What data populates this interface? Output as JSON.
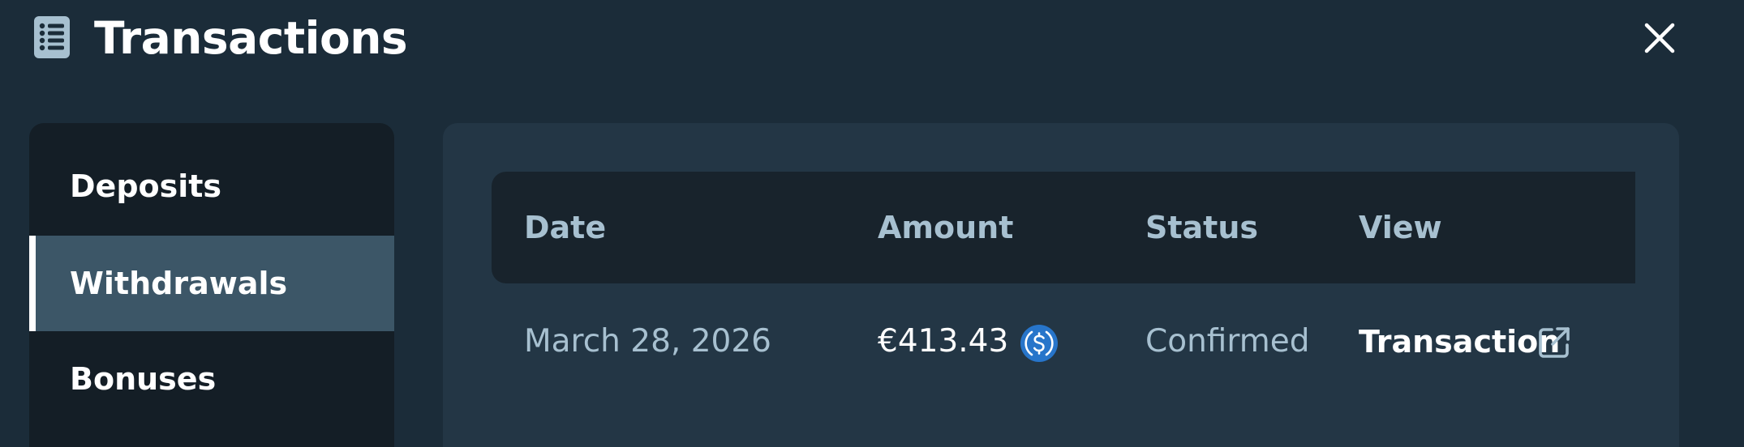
{
  "header": {
    "title": "Transactions",
    "title_icon": "list-document-icon",
    "close_icon": "close-icon"
  },
  "sidebar": {
    "items": [
      {
        "label": "Deposits",
        "active": false
      },
      {
        "label": "Withdrawals",
        "active": true
      },
      {
        "label": "Bonuses",
        "active": false
      }
    ]
  },
  "table": {
    "columns": [
      "Date",
      "Amount",
      "Status",
      "View"
    ],
    "rows": [
      {
        "date": "March 28, 2026",
        "amount": "€413.43",
        "currency_icon": "usdc-coin-icon",
        "status": "Confirmed",
        "view_label": "Transaction",
        "view_icon": "external-link-icon"
      }
    ]
  },
  "colors": {
    "background": "#1b2c39",
    "sidebar_bg": "#141e26",
    "sidebar_active": "#3c5667",
    "panel_bg": "#233645",
    "table_header_bg": "#18232c",
    "muted_text": "#a7c0d0",
    "coin_blue": "#2775ca"
  }
}
